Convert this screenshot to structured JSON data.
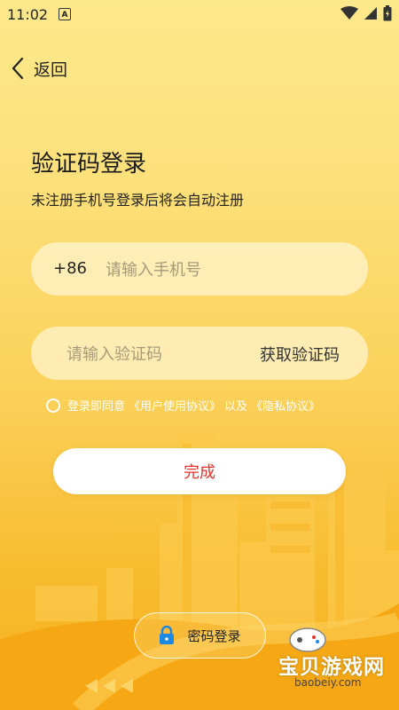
{
  "status_bar": {
    "time": "11:02",
    "app_badge": "A"
  },
  "header": {
    "back_label": "返回"
  },
  "page": {
    "title": "验证码登录",
    "subtitle": "未注册手机号登录后将会自动注册"
  },
  "phone_field": {
    "prefix": "+86",
    "placeholder": "请输入手机号",
    "value": ""
  },
  "code_field": {
    "placeholder": "请输入验证码",
    "value": "",
    "get_code_label": "获取验证码"
  },
  "agreement": {
    "prefix": "登录即同意",
    "user_agreement": "《用户使用协议》",
    "connector": "以及",
    "privacy_policy": "《隐私协议》",
    "checked": false
  },
  "actions": {
    "done_label": "完成",
    "password_login_label": "密码登录"
  },
  "watermark": {
    "site_name": "宝贝游戏网",
    "url": "baobeiy.com"
  },
  "colors": {
    "accent_red": "#E8332B",
    "bg_top": "#FCE98B",
    "bg_bottom": "#F6B01E",
    "lock_blue": "#1E88E5"
  },
  "icons": {
    "back": "chevron-left-icon",
    "lock": "lock-icon",
    "wifi": "wifi-icon",
    "signal": "signal-icon",
    "battery": "battery-icon"
  }
}
